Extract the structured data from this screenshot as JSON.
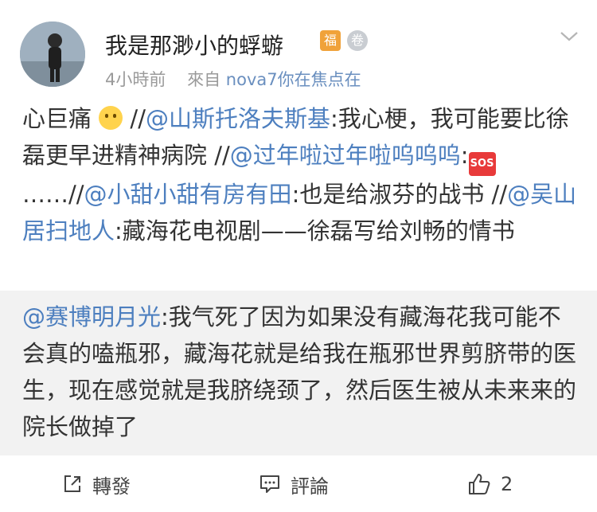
{
  "post": {
    "username": "我是那渺小的蜉蝣",
    "badges": {
      "fu": "福",
      "medal": "卷"
    },
    "meta": {
      "time": "4小時前",
      "from_label": "來自",
      "source": "nova7你在焦点在"
    },
    "body": [
      {
        "type": "text",
        "text": "心巨痛 "
      },
      {
        "type": "emoji",
        "name": "smile-emoji"
      },
      {
        "type": "text",
        "text": " //"
      },
      {
        "type": "at",
        "text": "@山斯托洛夫斯基"
      },
      {
        "type": "text",
        "text": ":我心梗，我可能要比徐磊更早进精神病院 //"
      },
      {
        "type": "at",
        "text": "@过年啦过年啦呜呜呜"
      },
      {
        "type": "text",
        "text": ":"
      },
      {
        "type": "sos",
        "text": "SOS"
      },
      {
        "type": "text",
        "text": "……//"
      },
      {
        "type": "at",
        "text": "@小甜小甜有房有田"
      },
      {
        "type": "text",
        "text": ":也是给淑芬的战书 //"
      },
      {
        "type": "at",
        "text": "@吴山居扫地人"
      },
      {
        "type": "text",
        "text": ":藏海花电视剧——徐磊写给刘畅的情书"
      }
    ]
  },
  "repost": {
    "author": "@赛博明月光",
    "text": ":我气死了因为如果没有藏海花我可能不会真的嗑瓶邪，藏海花就是给我在瓶邪世界剪脐带的医生，现在感觉就是我脐绕颈了，然后医生被从未来来的院长做掉了"
  },
  "actions": {
    "repost_label": "轉發",
    "comment_label": "評論",
    "like_count": "2"
  }
}
